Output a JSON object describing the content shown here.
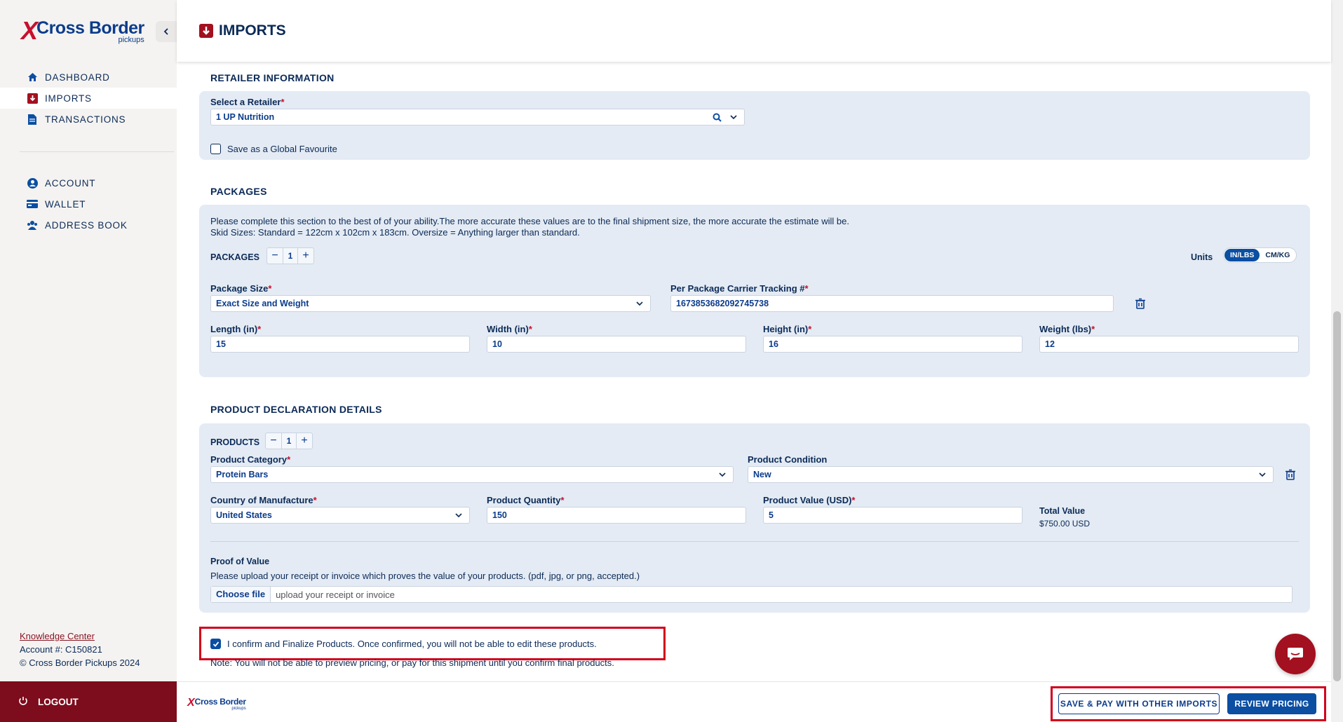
{
  "brand": {
    "name": "Cross Border",
    "sub": "pickups",
    "mark": "X"
  },
  "sidebar": {
    "items": [
      {
        "label": "DASHBOARD",
        "icon": "home-icon"
      },
      {
        "label": "IMPORTS",
        "icon": "imports-icon"
      },
      {
        "label": "TRANSACTIONS",
        "icon": "document-icon"
      },
      {
        "label": "ACCOUNT",
        "icon": "user-circle-icon"
      },
      {
        "label": "WALLET",
        "icon": "wallet-icon"
      },
      {
        "label": "ADDRESS BOOK",
        "icon": "address-book-icon"
      }
    ],
    "knowledge_center": "Knowledge Center",
    "account": "Account #: C150821",
    "copyright": "© Cross Border Pickups 2024",
    "logout": "LOGOUT"
  },
  "header": {
    "title": "IMPORTS"
  },
  "retailer": {
    "section_title": "RETAILER INFORMATION",
    "select_label": "Select a Retailer",
    "selected": "1 UP Nutrition",
    "global_fav_label": "Save as a Global Favourite",
    "global_fav_checked": false
  },
  "packages": {
    "section_title": "PACKAGES",
    "info_line1": "Please complete this section to the best of of your ability.The more accurate these values are to the final shipment size, the more accurate the estimate will be.",
    "info_line2": "Skid Sizes: Standard = 122cm x 102cm x 183cm. Oversize = Anything larger than standard.",
    "count_label": "PACKAGES",
    "count": "1",
    "units_label": "Units",
    "unit_options": [
      "IN/LBS",
      "CM/KG"
    ],
    "unit_selected": "IN/LBS",
    "size_label": "Package Size",
    "size_value": "Exact Size and Weight",
    "tracking_label": "Per Package Carrier Tracking #",
    "tracking_value": "1673853682092745738",
    "length_label": "Length (in)",
    "length": "15",
    "width_label": "Width (in)",
    "width": "10",
    "height_label": "Height (in)",
    "height": "16",
    "weight_label": "Weight (lbs)",
    "weight": "12"
  },
  "products": {
    "section_title": "PRODUCT DECLARATION DETAILS",
    "count_label": "PRODUCTS",
    "count": "1",
    "category_label": "Product Category",
    "category": "Protein Bars",
    "condition_label": "Product Condition",
    "condition": "New",
    "country_label": "Country of Manufacture",
    "country": "United States",
    "quantity_label": "Product Quantity",
    "quantity": "150",
    "value_label": "Product Value (USD)",
    "value": "5",
    "total_label": "Total Value",
    "total": "$750.00 USD",
    "proof_label": "Proof of Value",
    "proof_help": "Please upload your receipt or invoice which proves the value of your products. (pdf, jpg, or png, accepted.)",
    "choose_file": "Choose file",
    "file_placeholder": "upload your receipt or invoice"
  },
  "confirm": {
    "label": "I confirm and Finalize Products. Once confirmed, you will not be able to edit these products.",
    "checked": true,
    "note": "Note: You will not be able to preview pricing, or pay for this shipment until you confirm final products."
  },
  "footer": {
    "save_pay": "SAVE & PAY WITH OTHER IMPORTS",
    "review": "REVIEW PRICING"
  },
  "colors": {
    "brand_red": "#c8102e",
    "navy": "#0b2a57",
    "blue": "#0b4ea2",
    "panel": "#e4ebf4",
    "logout_bg": "#7d0c1d",
    "highlight": "#d0021b"
  }
}
